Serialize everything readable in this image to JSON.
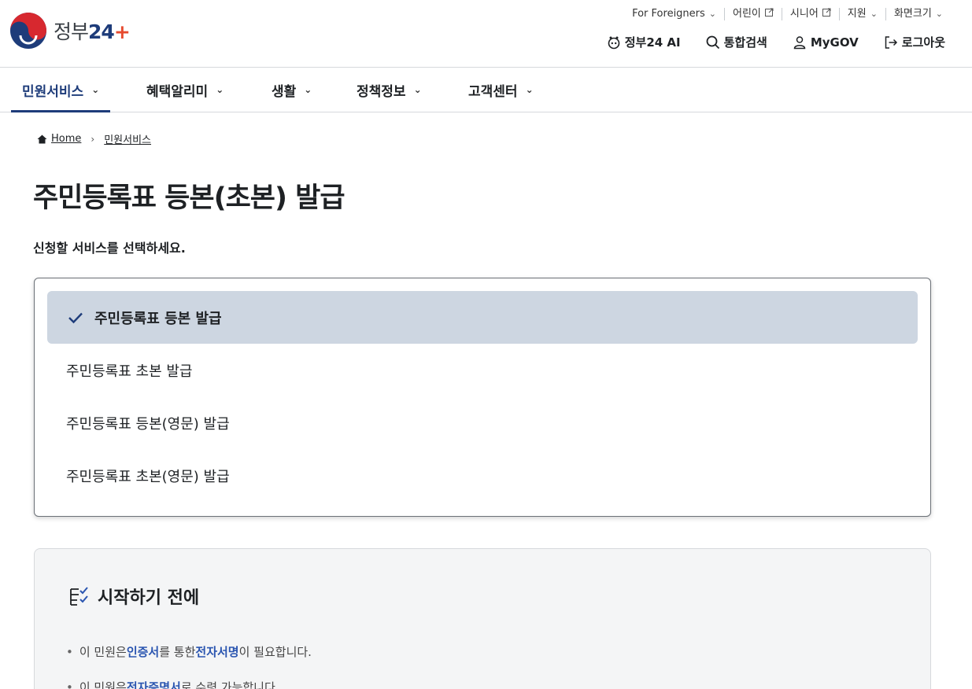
{
  "header": {
    "logo_text": "정부",
    "logo_num": "24",
    "logo_plus": "+",
    "util_links": [
      {
        "label": "For Foreigners",
        "icon": "chevron-down-icon"
      },
      {
        "label": "어린이",
        "icon": "external-link-icon"
      },
      {
        "label": "시니어",
        "icon": "external-link-icon"
      },
      {
        "label": "지원",
        "icon": "chevron-down-icon"
      },
      {
        "label": "화면크기",
        "icon": "chevron-down-icon"
      }
    ],
    "main_links": [
      {
        "label": "정부24 AI",
        "icon": "ai-assistant-icon"
      },
      {
        "label": "통합검색",
        "icon": "search-icon"
      },
      {
        "label": "MyGOV",
        "icon": "user-icon"
      },
      {
        "label": "로그아웃",
        "icon": "logout-icon"
      }
    ]
  },
  "gnb": {
    "items": [
      {
        "label": "민원서비스",
        "active": true
      },
      {
        "label": "혜택알리미",
        "active": false
      },
      {
        "label": "생활",
        "active": false
      },
      {
        "label": "정책정보",
        "active": false
      },
      {
        "label": "고객센터",
        "active": false
      }
    ]
  },
  "breadcrumb": {
    "home": "Home",
    "current": "민원서비스"
  },
  "page": {
    "title": "주민등록표 등본(초본) 발급",
    "subtitle": "신청할 서비스를 선택하세요."
  },
  "options": [
    {
      "label": "주민등록표 등본 발급",
      "selected": true
    },
    {
      "label": "주민등록표 초본 발급",
      "selected": false
    },
    {
      "label": "주민등록표 등본(영문) 발급",
      "selected": false
    },
    {
      "label": "주민등록표 초본(영문) 발급",
      "selected": false
    }
  ],
  "before_start": {
    "title": "시작하기 전에",
    "line1": {
      "prefix": "이 민원은 ",
      "hl1": "인증서",
      "mid": "를 통한 ",
      "hl2": "전자서명",
      "suffix": "이 필요합니다."
    },
    "line2": {
      "prefix": "이 민원은 ",
      "hl1": "전자증명서",
      "suffix": "로 수령 가능합니다."
    }
  },
  "colors": {
    "brand_navy": "#1e3c7a",
    "selected_bg": "#cdd6e1",
    "highlight_link": "#2a55b0"
  }
}
